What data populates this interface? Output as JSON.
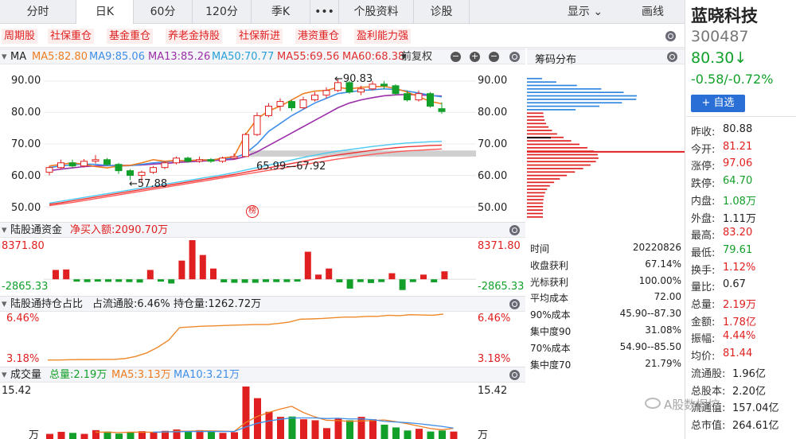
{
  "tabs": [
    "分时",
    "日K",
    "60分",
    "120分",
    "季K",
    "•••",
    "个股资料",
    "诊股"
  ],
  "top_right": {
    "display": "显示",
    "draw": "画线"
  },
  "tags": [
    "周期股",
    "社保重仓",
    "基金重仓",
    "养老金持股",
    "社保新进",
    "港资重仓",
    "盈利能力强"
  ],
  "ma_header": {
    "ma": "MA",
    "ma5": "MA5:82.80",
    "ma9": "MA9:85.06",
    "ma13": "MA13:85.26",
    "ma50": "MA50:70.77",
    "ma55": "MA55:69.56",
    "ma60": "MA60:68.38",
    "adjust": "前复权"
  },
  "price_axis": [
    "90.00",
    "80.00",
    "70.00",
    "60.00",
    "50.00"
  ],
  "annotations": {
    "high": "←90.83",
    "low": "←57.88",
    "range": "65.99—67.92",
    "bang": "榜"
  },
  "chip": {
    "title": "筹码分布",
    "rows": [
      [
        "时间",
        "20220826"
      ],
      [
        "收盘获利",
        "67.14%"
      ],
      [
        "光标获利",
        "100.00%"
      ],
      [
        "平均成本",
        "72.00"
      ],
      [
        "90%成本",
        "45.90--87.30"
      ],
      [
        "集中度90",
        "31.08%"
      ],
      [
        "70%成本",
        "54.90--85.50"
      ],
      [
        "集中度70",
        "21.79%"
      ]
    ]
  },
  "lgt": {
    "title": "陆股通资金",
    "net": "净买入额:2090.70万",
    "top": "8371.80",
    "bottom": "-2865.33"
  },
  "hold": {
    "title": "陆股通持仓占比",
    "ratio": "占流通股:6.46%",
    "amount": "持仓量:1262.72万",
    "top": "6.46%",
    "bottom": "3.18%"
  },
  "vol": {
    "title": "成交量",
    "total": "总量:2.19万",
    "ma5": "MA5:3.13万",
    "ma10": "MA10:3.21万",
    "top": "15.42",
    "unit": "万"
  },
  "stock": {
    "name": "蓝晓科技",
    "code": "300487",
    "price": "80.30↓",
    "change": "-0.58/-0.72%",
    "add": "+ 自选"
  },
  "quotes": [
    [
      "昨收:",
      "80.88"
    ],
    [
      "今开:",
      "81.21"
    ],
    [
      "涨停:",
      "97.06"
    ],
    [
      "跌停:",
      "64.70"
    ],
    [
      "内盘:",
      "1.08万"
    ],
    [
      "外盘:",
      "1.11万"
    ],
    [
      "最高:",
      "83.20"
    ],
    [
      "最低:",
      "79.61"
    ],
    [
      "换手:",
      "1.12%"
    ],
    [
      "量比:",
      "0.67"
    ],
    [
      "总量:",
      "2.19万"
    ],
    [
      "金额:",
      "1.78亿"
    ],
    [
      "振幅:",
      "4.44%"
    ],
    [
      "均价:",
      "81.44"
    ],
    [
      "流通股:",
      "1.96亿"
    ],
    [
      "总股本:",
      "2.20亿"
    ],
    [
      "流通值:",
      "157.04亿"
    ],
    [
      "总市值:",
      "264.61亿"
    ]
  ],
  "watermark": "A股数据控",
  "colors": {
    "up": "#e02020",
    "down": "#12a02a",
    "ma5": "#ee7d22",
    "ma9": "#3f8fe8",
    "ma13": "#9b2fa9",
    "ma50": "#4cc9f0",
    "ma55": "#ee3333",
    "ma60": "#ff5a5a"
  },
  "chart_data": [
    {
      "type": "line",
      "title": "日K",
      "ylim": [
        47,
        93
      ],
      "series": [
        {
          "name": "MA5",
          "values": [
            63,
            63.5,
            64,
            63.5,
            62.8,
            62.4,
            63,
            63.2,
            64,
            65,
            64.5,
            64.8,
            64.6,
            65,
            64.8,
            65.5,
            66,
            73,
            78,
            80.5,
            82,
            84,
            86,
            86.8,
            87,
            88,
            87.5,
            88,
            88.2,
            88.3,
            87.6,
            86.5,
            85,
            83.5,
            82.8
          ]
        },
        {
          "name": "MA9",
          "values": [
            62.5,
            63,
            63.4,
            63.6,
            63.5,
            63.2,
            63,
            63.1,
            63.5,
            64,
            64.3,
            64.6,
            64.7,
            64.9,
            65,
            65.2,
            65.5,
            67,
            70,
            74,
            76.5,
            79,
            81,
            83,
            84.5,
            86,
            86.5,
            87,
            87.2,
            87.5,
            87.3,
            86.8,
            86.2,
            85.5,
            85
          ]
        },
        {
          "name": "MA13",
          "values": [
            61.5,
            62,
            62.4,
            62.8,
            63,
            63.1,
            63.2,
            63.2,
            63.3,
            63.6,
            63.8,
            64.1,
            64.3,
            64.5,
            64.7,
            64.9,
            65.1,
            66,
            67.5,
            69.5,
            71.5,
            73.5,
            75.5,
            77.5,
            79.5,
            81.5,
            83,
            84,
            84.7,
            85.3,
            85.6,
            85.7,
            85.6,
            85.4,
            85.2
          ]
        },
        {
          "name": "MA50",
          "values": [
            51.2,
            51.8,
            52.4,
            53,
            53.6,
            54.2,
            54.8,
            55.4,
            56,
            56.6,
            57.2,
            57.8,
            58.4,
            59,
            59.6,
            60.2,
            60.9,
            61.7,
            62.5,
            63.3,
            64.1,
            64.9,
            65.7,
            66.4,
            67.1,
            67.7,
            68.2,
            68.7,
            69.2,
            69.6,
            70,
            70.3,
            70.5,
            70.7,
            70.8
          ]
        },
        {
          "name": "MA55",
          "values": [
            50.8,
            51.3,
            51.9,
            52.5,
            53.1,
            53.7,
            54.3,
            54.9,
            55.5,
            56.1,
            56.7,
            57.3,
            57.9,
            58.5,
            59.1,
            59.7,
            60.3,
            61,
            61.7,
            62.4,
            63.1,
            63.8,
            64.5,
            65.2,
            65.9,
            66.5,
            67,
            67.5,
            68,
            68.4,
            68.8,
            69.1,
            69.3,
            69.5,
            69.6
          ]
        },
        {
          "name": "MA60",
          "values": [
            50.4,
            50.9,
            51.4,
            52,
            52.6,
            53.2,
            53.8,
            54.4,
            55,
            55.6,
            56.2,
            56.8,
            57.4,
            58,
            58.6,
            59.2,
            59.8,
            60.4,
            61,
            61.6,
            62.2,
            62.8,
            63.4,
            64,
            64.6,
            65.2,
            65.7,
            66.2,
            66.7,
            67.1,
            67.5,
            67.8,
            68,
            68.2,
            68.4
          ]
        }
      ]
    },
    {
      "type": "bar",
      "title": "日K",
      "candles": [
        [
          61,
          62.5,
          60,
          63
        ],
        [
          62.5,
          64,
          62,
          65
        ],
        [
          64,
          63,
          62.5,
          65
        ],
        [
          63,
          64.5,
          62.5,
          65.2
        ],
        [
          64.5,
          65,
          63.8,
          66.5
        ],
        [
          65,
          63.5,
          63,
          65.5
        ],
        [
          63.5,
          61.5,
          60.5,
          64
        ],
        [
          61.5,
          60,
          58.5,
          62
        ],
        [
          60,
          61,
          57.88,
          61.5
        ],
        [
          61,
          62.5,
          60.5,
          63
        ],
        [
          62.5,
          64,
          62,
          64.5
        ],
        [
          64,
          65.5,
          63.5,
          66
        ],
        [
          65.5,
          64.5,
          64,
          66
        ],
        [
          64.5,
          65,
          64,
          66
        ],
        [
          65,
          64.5,
          64,
          65.5
        ],
        [
          64.5,
          65.5,
          64,
          66
        ],
        [
          65.5,
          66,
          65,
          67
        ],
        [
          66,
          73,
          65.99,
          73.5
        ],
        [
          73,
          79,
          72.5,
          80
        ],
        [
          79,
          82,
          78.5,
          83
        ],
        [
          82,
          83.5,
          80.5,
          84.5
        ],
        [
          83.5,
          81.5,
          80.5,
          84
        ],
        [
          81.5,
          84,
          81,
          85
        ],
        [
          84,
          85.5,
          83.5,
          86.5
        ],
        [
          85.5,
          87,
          84.5,
          88
        ],
        [
          87,
          89.5,
          86.5,
          90.83
        ],
        [
          89.5,
          86.5,
          86,
          90
        ],
        [
          86.5,
          87.5,
          85.5,
          88.5
        ],
        [
          87.5,
          89,
          87,
          90
        ],
        [
          89,
          88.5,
          87.5,
          90
        ],
        [
          88.5,
          86,
          85.5,
          89
        ],
        [
          86,
          84,
          83.5,
          87
        ],
        [
          84,
          86,
          83.5,
          87
        ],
        [
          86,
          82,
          81.5,
          86.5
        ],
        [
          81.21,
          80.3,
          79.61,
          83.2
        ]
      ]
    },
    {
      "type": "bar",
      "title": "陆股通资金",
      "ylim": [
        -2865.33,
        8371.8
      ],
      "values": [
        2000,
        2100,
        -500,
        -600,
        -500,
        -550,
        -550,
        -600,
        -700,
        2000,
        -500,
        -900,
        4000,
        8371.8,
        5200,
        2300,
        -650,
        -750,
        -750,
        -750,
        -600,
        -600,
        -600,
        -500,
        5900,
        1000,
        2300,
        -650,
        -2000,
        -600,
        -800,
        -600,
        1300,
        -2300,
        -600,
        1000,
        -650,
        1700
      ]
    },
    {
      "type": "line",
      "title": "陆股通持仓占比",
      "ylim": [
        3.18,
        6.46
      ],
      "series": [
        {
          "name": "占流通股",
          "values": [
            3.2,
            3.2,
            3.22,
            3.23,
            3.23,
            3.24,
            3.24,
            3.3,
            3.45,
            3.7,
            4.1,
            4.6,
            5.5,
            5.55,
            5.6,
            5.62,
            5.65,
            5.68,
            5.7,
            5.72,
            5.72,
            5.8,
            5.9,
            6.1,
            6.12,
            6.15,
            6.2,
            6.25,
            6.25,
            6.3,
            6.3,
            6.38,
            6.35,
            6.42,
            6.4,
            6.38,
            6.46
          ]
        }
      ]
    },
    {
      "type": "bar",
      "title": "成交量",
      "ylim": [
        0,
        15.42
      ],
      "values": [
        1.5,
        2.1,
        1.8,
        1.5,
        2.6,
        2.2,
        1.6,
        1.9,
        2.3,
        2.0,
        2.4,
        2.8,
        2.2,
        2.6,
        2.1,
        1.8,
        2.0,
        15.42,
        12.0,
        8.0,
        6.5,
        6.6,
        5.8,
        5.5,
        3.2,
        6.0,
        5.5,
        6.5,
        5.8,
        4.2,
        3.4,
        2.5,
        3.0,
        2.2,
        2.5,
        2.19
      ],
      "series": [
        {
          "name": "MA5",
          "values": [
            null,
            null,
            null,
            null,
            2.0,
            2.0,
            1.9,
            2.0,
            2.0,
            2.0,
            2.0,
            2.3,
            2.3,
            2.4,
            2.4,
            2.3,
            2.2,
            4.8,
            6.6,
            7.8,
            8.8,
            9.6,
            7.8,
            6.5,
            5.5,
            5.4,
            5.2,
            5.3,
            5.4,
            5.6,
            5.1,
            4.5,
            3.8,
            3.1,
            2.7,
            3.13
          ]
        },
        {
          "name": "MA10",
          "values": [
            null,
            null,
            null,
            null,
            null,
            null,
            null,
            null,
            null,
            2.0,
            2.1,
            2.1,
            2.2,
            2.2,
            2.2,
            2.2,
            2.2,
            3.5,
            4.6,
            5.3,
            5.8,
            6.2,
            6.2,
            6.2,
            6.0,
            6.1,
            5.9,
            5.9,
            5.7,
            5.2,
            5.0,
            4.8,
            4.5,
            4.1,
            3.7,
            3.21
          ]
        }
      ]
    }
  ]
}
